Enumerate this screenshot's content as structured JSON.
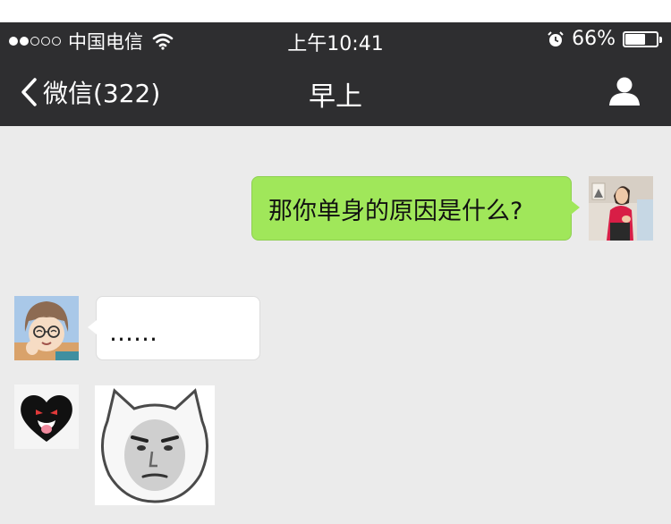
{
  "status_bar": {
    "carrier": "中国电信",
    "time": "上午10:41",
    "battery_percent": "66%",
    "battery_level": 0.66,
    "signal_full": 2,
    "signal_total": 5,
    "icons": [
      "signal-dots-icon",
      "wifi-icon",
      "alarm-icon",
      "battery-icon"
    ]
  },
  "nav": {
    "back_label": "微信(322)",
    "title": "早上",
    "icons": [
      "back-chevron-icon",
      "profile-icon"
    ]
  },
  "messages": [
    {
      "sender": "me",
      "type": "text",
      "text": "那你单身的原因是什么?"
    },
    {
      "sender": "them",
      "type": "text",
      "text": "……"
    },
    {
      "sender": "them-2",
      "type": "sticker",
      "sticker": "meme-cat-face-sticker"
    }
  ],
  "colors": {
    "bar_bg": "#2e2e30",
    "chat_bg": "#ebebeb",
    "my_bubble": "#a0e75a",
    "their_bubble": "#ffffff"
  }
}
